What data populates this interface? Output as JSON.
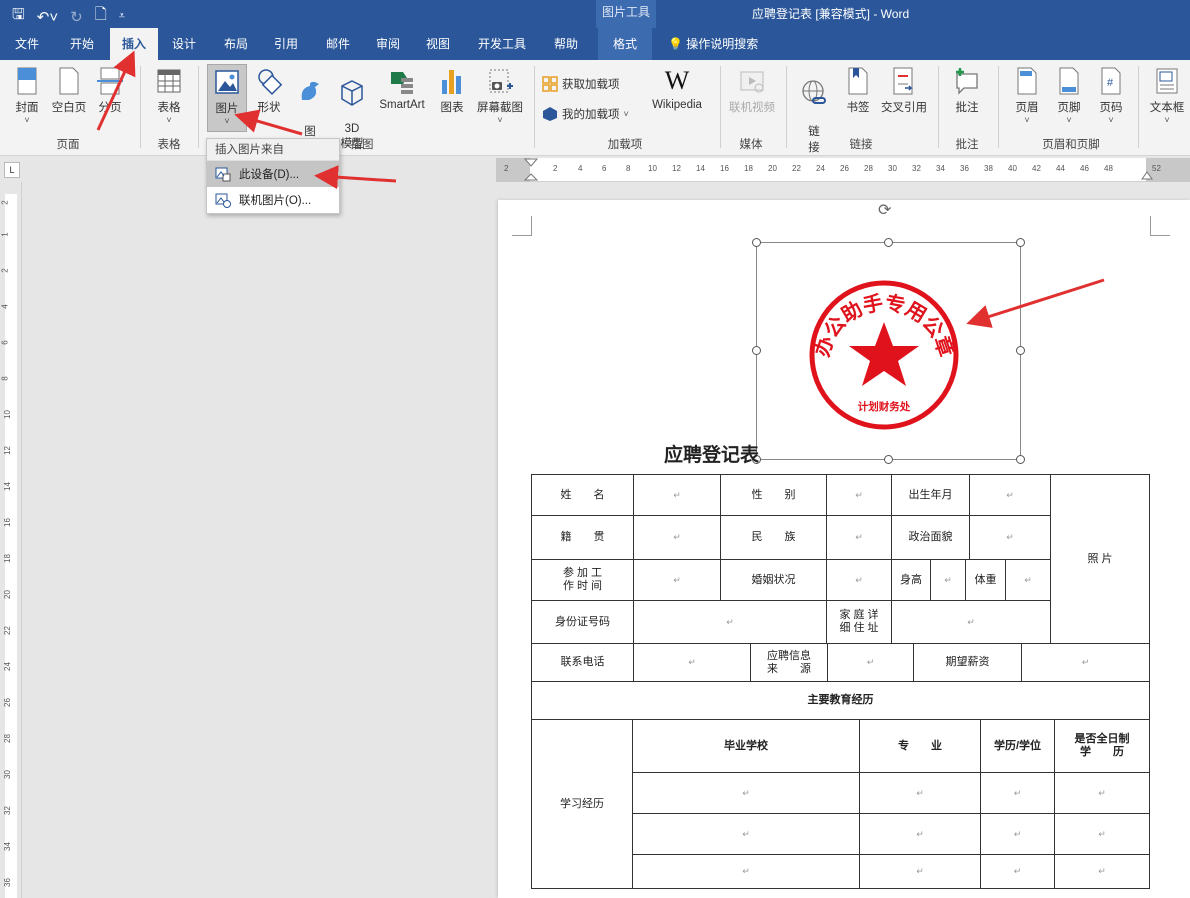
{
  "window": {
    "context_tools": "图片工具",
    "doc_title": "应聘登记表 [兼容模式] - Word",
    "qat_icons": [
      "save-icon",
      "undo-icon",
      "redo-icon",
      "print-preview-icon",
      "customize-icon"
    ]
  },
  "tabs": [
    "文件",
    "开始",
    "插入",
    "设计",
    "布局",
    "引用",
    "邮件",
    "审阅",
    "视图",
    "开发工具",
    "帮助",
    "格式"
  ],
  "active_tab": "插入",
  "tell_me": "操作说明搜索",
  "ribbon": {
    "pages": [
      "封面",
      "空白页",
      "分页"
    ],
    "pages_group": "页面",
    "table": "表格",
    "table_group": "表格",
    "pictures": "图片",
    "shapes": "形状",
    "icons": "图\n标",
    "models": "3D\n模型",
    "smartart": "SmartArt",
    "chart": "图表",
    "screenshot": "屏幕截图",
    "illus_group": "插图",
    "get_addins": "获取加载项",
    "my_addins": "我的加载项",
    "wikipedia": "Wikipedia",
    "addins_group": "加载项",
    "online_video": "联机视频",
    "media_group": "媒体",
    "link": "链\n接",
    "bookmark": "书签",
    "crossref": "交叉引用",
    "links_group": "链接",
    "comment": "批注",
    "comments_group": "批注",
    "header": "页眉",
    "footer": "页脚",
    "pagenum": "页码",
    "hf_group": "页眉和页脚",
    "textbox": "文本框"
  },
  "dropdown": {
    "header": "插入图片来自",
    "this_device": "此设备(D)...",
    "online": "联机图片(O)..."
  },
  "ruler": {
    "h_ticks": [
      "2",
      "2",
      "4",
      "6",
      "8",
      "10",
      "12",
      "14",
      "16",
      "18",
      "20",
      "22",
      "24",
      "26",
      "28",
      "30",
      "32",
      "34",
      "36",
      "38",
      "40",
      "42",
      "44",
      "46",
      "48",
      "52"
    ],
    "v_ticks": [
      "2",
      "1",
      "2",
      "4",
      "6",
      "8",
      "10",
      "12",
      "14",
      "16",
      "18",
      "20",
      "22",
      "24",
      "26",
      "28",
      "30",
      "32",
      "34",
      "36"
    ]
  },
  "seal": {
    "ring_text": "办公助手专用公章",
    "bottom_text": "计划财务处"
  },
  "form": {
    "title": "应聘登记表",
    "r1": [
      "姓　　名",
      "",
      "性　　别",
      "",
      "出生年月",
      "",
      "照 片"
    ],
    "r2": [
      "籍　　贯",
      "",
      "民　　族",
      "",
      "政治面貌",
      ""
    ],
    "r3": [
      "参 加 工\n作 时 间",
      "",
      "婚姻状况",
      "",
      "身高",
      "",
      "体重",
      ""
    ],
    "r4": [
      "身份证号码",
      "",
      "家 庭 详\n细 住 址",
      ""
    ],
    "r5": [
      "联系电话",
      "",
      "应聘信息\n来　　源",
      "",
      "期望薪资",
      ""
    ],
    "edu_header": "主要教育经历",
    "edu_label": "学习经历",
    "edu_cols": [
      "毕业学校",
      "专　　业",
      "学历/学位",
      "是否全日制\n学　　历"
    ],
    "pm": "↵"
  },
  "colors": {
    "titlebar": "#2b579a",
    "ribbon": "#f3f3f3",
    "seal_red": "#e0121c",
    "arrow_red": "#e03030"
  }
}
